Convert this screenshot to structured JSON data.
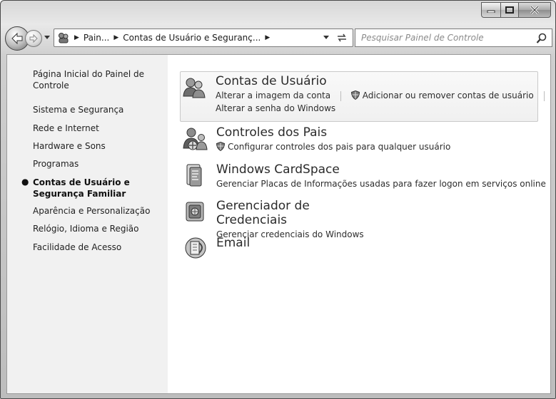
{
  "window": {
    "controls": {
      "minimize_icon": "minimize-icon",
      "maximize_icon": "maximize-icon",
      "close_icon": "close-icon"
    }
  },
  "navbar": {
    "breadcrumb": [
      "Pain...",
      "Contas de Usuário e Seguranç..."
    ],
    "search_placeholder": "Pesquisar Painel de Controle"
  },
  "sidebar": {
    "items": [
      {
        "label_line1": "Página Inicial do Painel de",
        "label_line2": "Controle"
      },
      {
        "label": "Sistema e Segurança"
      },
      {
        "label": "Rede e Internet"
      },
      {
        "label": "Hardware e Sons"
      },
      {
        "label": "Programas"
      },
      {
        "label_line1": "Contas de Usuário e",
        "label_line2": "Segurança Familiar",
        "active": true
      },
      {
        "label": "Aparência e Personalização"
      },
      {
        "label": "Relógio, Idioma e Região"
      },
      {
        "label": "Facilidade de Acesso"
      }
    ]
  },
  "categories": [
    {
      "title": "Contas de Usuário",
      "links": [
        "Alterar a imagem da conta",
        "Adicionar ou remover contas de usuário",
        "Alterar a senha do Windows"
      ],
      "icon": "users-icon"
    },
    {
      "title": "Controles dos Pais",
      "links": [
        "Configurar controles dos pais para qualquer usuário"
      ],
      "icon": "parental-controls-icon"
    },
    {
      "title": "Windows CardSpace",
      "links": [
        "Gerenciar Placas de Informações usadas para fazer logon em serviços online"
      ],
      "icon": "cardspace-icon"
    },
    {
      "title": "Gerenciador de Credenciais",
      "links": [
        "Gerenciar credenciais do Windows"
      ],
      "icon": "credential-vault-icon"
    },
    {
      "title": "Email",
      "links": [],
      "icon": "email-icon"
    }
  ]
}
